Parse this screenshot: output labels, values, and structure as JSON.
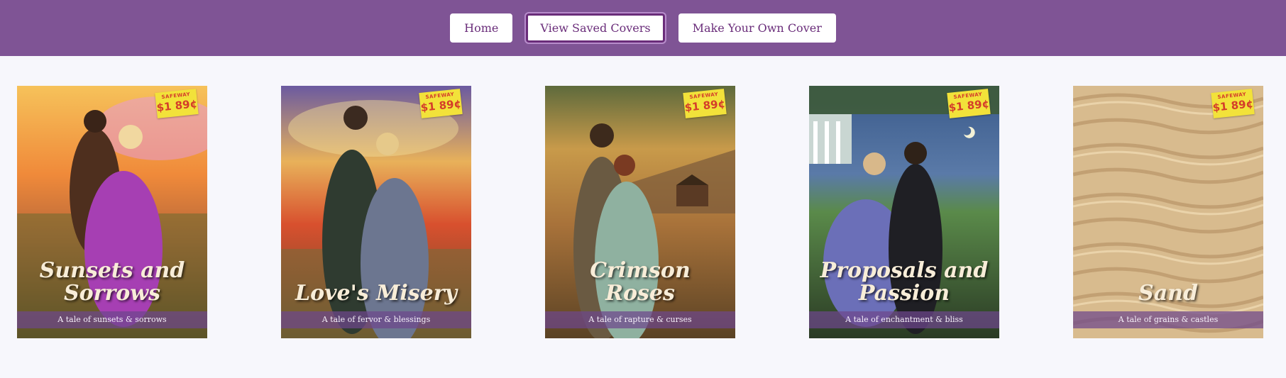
{
  "nav": {
    "home_label": "Home",
    "saved_label": "View Saved Covers",
    "make_label": "Make Your Own Cover"
  },
  "price_tag": {
    "store": "SAFEWAY",
    "amount": "$1 89¢"
  },
  "covers": [
    {
      "title": "Sunsets and Sorrows",
      "tagline": "A tale of sunsets & sorrows"
    },
    {
      "title": "Love's Misery",
      "tagline": "A tale of fervor & blessings"
    },
    {
      "title": "Crimson Roses",
      "tagline": "A tale of rapture & curses"
    },
    {
      "title": "Proposals and Passion",
      "tagline": "A tale of enchantment & bliss"
    },
    {
      "title": "Sand",
      "tagline": "A tale of grains & castles"
    }
  ],
  "colors": {
    "topbar": "#7f5495",
    "button_text": "#6a2d7a",
    "page_background": "#f7f7fc"
  }
}
